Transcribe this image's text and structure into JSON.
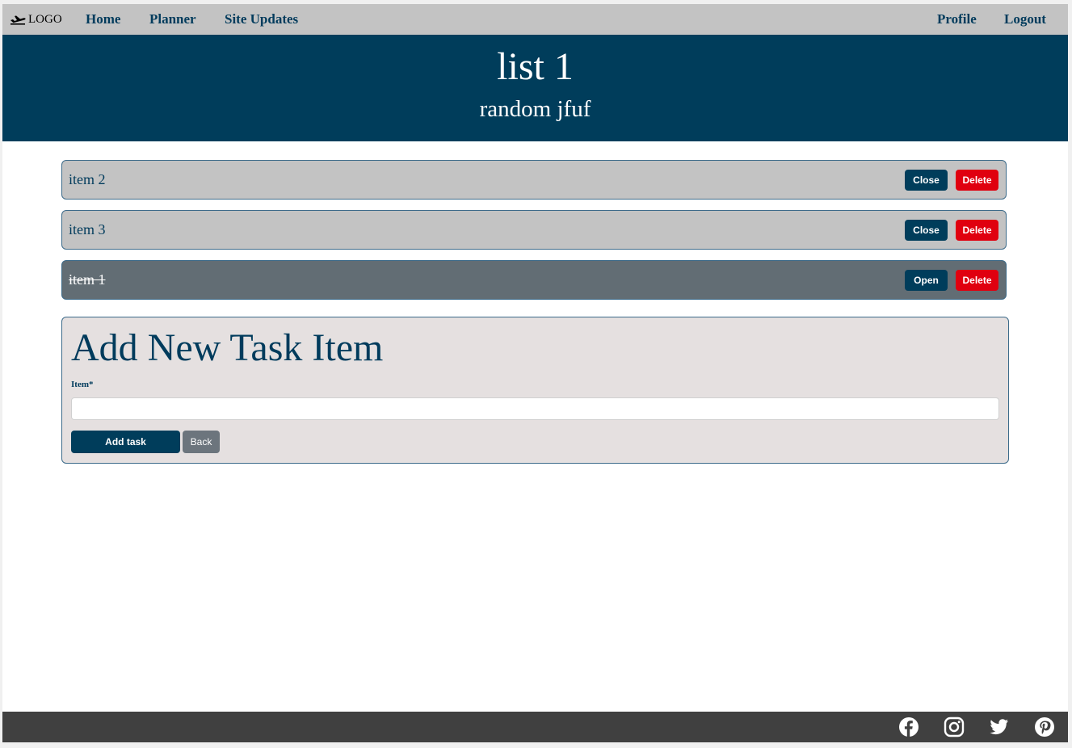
{
  "nav": {
    "logo_text": "LOGO",
    "logo_icon": "airplane-departure-icon",
    "links": [
      "Home",
      "Planner",
      "Site Updates"
    ],
    "right_links": [
      "Profile",
      "Logout"
    ]
  },
  "header": {
    "title": "list 1",
    "subtitle": "random jfuf"
  },
  "tasks": [
    {
      "label": "item 2",
      "toggle_label": "Close",
      "delete_label": "Delete",
      "completed": false
    },
    {
      "label": "item 3",
      "toggle_label": "Close",
      "delete_label": "Delete",
      "completed": false
    },
    {
      "label": "item 1",
      "toggle_label": "Open",
      "delete_label": "Delete",
      "completed": true
    }
  ],
  "add_form": {
    "heading": "Add New Task Item",
    "field_label": "Item*",
    "input_value": "",
    "submit_label": "Add task",
    "back_label": "Back"
  },
  "footer": {
    "social_icons": [
      "facebook-icon",
      "instagram-icon",
      "twitter-icon",
      "pinterest-icon"
    ]
  },
  "colors": {
    "nav_bg": "#c3c3c3",
    "brand_navy": "#003d5b",
    "delete_red": "#e0000f",
    "completed_row": "#626d74",
    "form_bg": "#e5e0e0",
    "footer_bg": "#404040"
  }
}
